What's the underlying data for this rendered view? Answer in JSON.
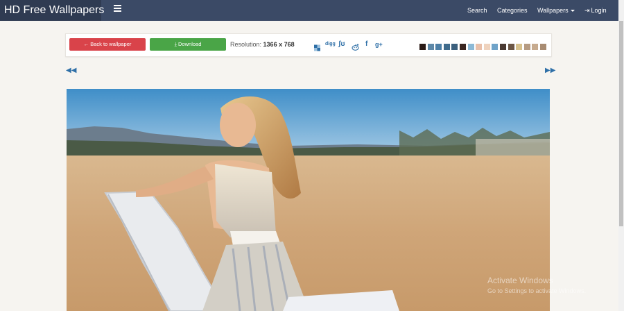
{
  "navbar": {
    "brand": "HD Free Wallpapers",
    "links": {
      "search": "Search",
      "categories": "Categories",
      "wallpapers": "Wallpapers",
      "login": "Login"
    }
  },
  "toolbar": {
    "back_label": "Back to wallpaper",
    "download_label": "Download",
    "resolution_label": "Resolution:",
    "resolution_value": "1366 x 768",
    "social": {
      "digg": "digg",
      "facebook": "f",
      "google_plus": "g+"
    },
    "palette": [
      "#2a1a16",
      "#5d88a8",
      "#4d7fa6",
      "#3f6b8c",
      "#3b5f7d",
      "#3a2620",
      "#8cb9d6",
      "#e9c0aa",
      "#efd3be",
      "#6fa3c9",
      "#4a3a33",
      "#6c5645",
      "#d8c28e",
      "#b69b82",
      "#c7ab8f",
      "#a88c72"
    ]
  },
  "colors": {
    "navbar_bg": "#3b4a66",
    "brand_bg": "#2f3b52",
    "back_button": "#d9434a",
    "download_button": "#4aa547",
    "link_blue": "#2e6fa7"
  },
  "icons": {
    "back": "arrow-left-icon",
    "download": "download-icon",
    "prev": "double-arrow-left-icon",
    "next": "double-arrow-right-icon"
  },
  "watermark": {
    "title": "Activate Windows",
    "subtitle": "Go to Settings to activate Windows."
  }
}
